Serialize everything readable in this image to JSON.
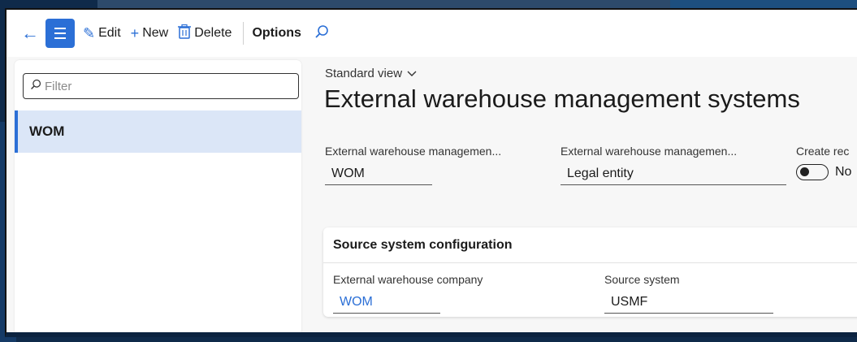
{
  "toolbar": {
    "edit_label": "Edit",
    "new_label": "New",
    "delete_label": "Delete",
    "options_label": "Options"
  },
  "list": {
    "filter_placeholder": "Filter",
    "items": [
      {
        "label": "WOM",
        "selected": true
      }
    ]
  },
  "main": {
    "view_label": "Standard view",
    "title": "External warehouse management systems",
    "fields": [
      {
        "label": "External warehouse managemen...",
        "value": "WOM"
      },
      {
        "label": "External warehouse managemen...",
        "value": "Legal entity"
      },
      {
        "label": "Create rec",
        "value": "No"
      }
    ],
    "card": {
      "title": "Source system configuration",
      "fields": [
        {
          "label": "External warehouse company",
          "value": "WOM"
        },
        {
          "label": "Source system",
          "value": "USMF"
        }
      ]
    }
  },
  "colors": {
    "accent": "#2b6fd6",
    "selected_row": "#dbe6f7"
  }
}
